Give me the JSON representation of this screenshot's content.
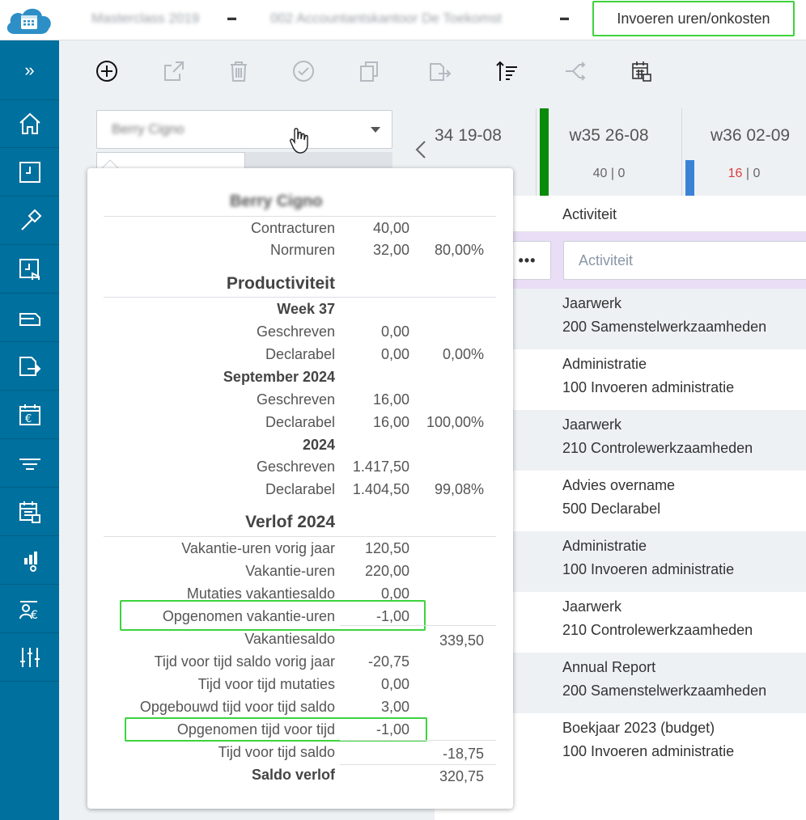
{
  "header": {
    "crumb1": "Masterclass 2019",
    "crumb2": "002 Accountantskantoor De Toekomst",
    "action_label": "Invoeren uren/onkosten"
  },
  "sidebar": {
    "expand_label": "»",
    "icons": [
      "home-icon",
      "clock-icon",
      "hammer-icon",
      "clock-hand-icon",
      "invoice-icon",
      "invoice-send-icon",
      "calendar-euro-icon",
      "filter-icon",
      "calendar-grid-icon",
      "chart-search-icon",
      "people-euro-icon",
      "sliders-icon"
    ]
  },
  "employee": {
    "name": "Berry Cigno"
  },
  "weeks": [
    {
      "label": "34 19-08",
      "hours": "",
      "second": ""
    },
    {
      "label": "w35 26-08",
      "hours": "40",
      "second": "0"
    },
    {
      "label": "w36 02-09",
      "hours": "16",
      "second": "0"
    }
  ],
  "grid": {
    "header_activity": "Activiteit",
    "filter_placeholder": "Activiteit",
    "dots": "•••",
    "rows": [
      {
        "l1": "Jaarwerk",
        "l2": "200 Samenstelwerkzaamheden"
      },
      {
        "l1": "Administratie",
        "l2": "100 Invoeren administratie"
      },
      {
        "l1": "Jaarwerk",
        "l2": "210 Controlewerkzaamheden"
      },
      {
        "l1": "Advies overname",
        "l2": "500 Declarabel"
      },
      {
        "l1": "Administratie",
        "l2": "100 Invoeren administratie"
      },
      {
        "l1": "Jaarwerk",
        "l2": "210 Controlewerkzaamheden"
      },
      {
        "l1": "Annual Report",
        "l2": "200 Samenstelwerkzaamheden"
      },
      {
        "l1": "Boekjaar 2023 (budget)",
        "l2": "100 Invoeren administratie"
      }
    ]
  },
  "popover": {
    "name": "Berry Cigno",
    "contract_label": "Contracturen",
    "contract_value": "40,00",
    "norm_label": "Normuren",
    "norm_value": "32,00",
    "norm_pct": "80,00%",
    "prod_title": "Productiviteit",
    "week_title": "Week 37",
    "week_written_label": "Geschreven",
    "week_written": "0,00",
    "week_decl_label": "Declarabel",
    "week_decl": "0,00",
    "week_decl_pct": "0,00%",
    "month_title": "September 2024",
    "month_written_label": "Geschreven",
    "month_written": "16,00",
    "month_decl_label": "Declarabel",
    "month_decl": "16,00",
    "month_decl_pct": "100,00%",
    "year_title": "2024",
    "year_written_label": "Geschreven",
    "year_written": "1.417,50",
    "year_decl_label": "Declarabel",
    "year_decl": "1.404,50",
    "year_decl_pct": "99,08%",
    "leave_title": "Verlof 2024",
    "vac_prev_label": "Vakantie-uren vorig jaar",
    "vac_prev": "120,50",
    "vac_label": "Vakantie-uren",
    "vac": "220,00",
    "mut_label": "Mutaties vakantiesaldo",
    "mut": "0,00",
    "taken_label": "Opgenomen vakantie-uren",
    "taken": "-1,00",
    "vac_balance_label": "Vakantiesaldo",
    "vac_balance": "339,50",
    "tvt_prev_label": "Tijd voor tijd saldo vorig jaar",
    "tvt_prev": "-20,75",
    "tvt_mut_label": "Tijd voor tijd mutaties",
    "tvt_mut": "0,00",
    "tvt_built_label": "Opgebouwd tijd voor tijd saldo",
    "tvt_built": "3,00",
    "tvt_taken_label": "Opgenomen tijd voor tijd",
    "tvt_taken": "-1,00",
    "tvt_balance_label": "Tijd voor tijd saldo",
    "tvt_balance": "-18,75",
    "total_label": "Saldo verlof",
    "total": "320,75"
  },
  "colors": {
    "sidebar": "#00709e",
    "highlight": "#3dd33d",
    "week_bar_green": "#0a8a0a",
    "week_bar_blue": "#3b82d6",
    "red_value": "#e03b3b"
  }
}
